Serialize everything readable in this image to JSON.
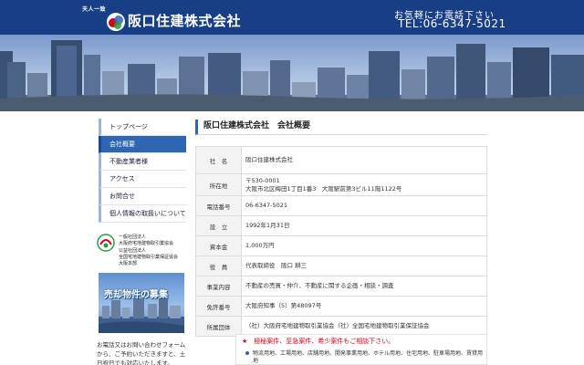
{
  "header": {
    "tagline": "天人一致",
    "company_name": "阪口住建株式会社",
    "call_text": "お気軽にお電話下さい",
    "tel": "TEL:06-6347-5021"
  },
  "colors": {
    "header_bg": "#183f86",
    "accent": "#2f66b3",
    "alert_red": "#d6001c"
  },
  "nav": {
    "items": [
      {
        "label": "トップページ",
        "active": false
      },
      {
        "label": "会社概要",
        "active": true
      },
      {
        "label": "不動産業者様",
        "active": false
      },
      {
        "label": "アクセス",
        "active": false
      },
      {
        "label": "お問合せ",
        "active": false
      },
      {
        "label": "個人情報の取扱いについて",
        "active": false
      }
    ]
  },
  "association": {
    "line1": "一般社団法人",
    "line2": "大阪府宅地建物取引業協会",
    "line3": "公益社団法人",
    "line4": "全国宅地建物取引業保証協会",
    "line5": "大阪本部"
  },
  "sale_banner": {
    "title": "売却物件の募集"
  },
  "side_note": {
    "text": "お電話又はお問い合わせフォームから、ご予約いただきますと、土日祝日でも対応いたします。"
  },
  "main": {
    "title": "阪口住建株式会社　会社概要",
    "rows": [
      {
        "label": "社　名",
        "value": "阪口住建株式会社"
      },
      {
        "label": "所在地",
        "value": "〒530-0001\n大阪市北区梅田1丁目1番3　大阪駅前第3ビル11階1122号"
      },
      {
        "label": "電話番号",
        "value": "06-6347-5021"
      },
      {
        "label": "設　立",
        "value": "1992年1月31日"
      },
      {
        "label": "資本金",
        "value": "1,000万円"
      },
      {
        "label": "役　員",
        "value": "代表取締役　阪口 耕三"
      },
      {
        "label": "事業内容",
        "value": "不動産の売買・仲介、不動産に関する企画・相談・調査"
      },
      {
        "label": "免許番号",
        "value": "大阪府知事（5）第48097号"
      },
      {
        "label": "所属団体",
        "value": "（社）大阪府宅地建物取引業協会（社）全国宅地建物取引業保証協会"
      }
    ],
    "notice_head": "★　極秘案件、至急案件、希少案件もご相談下さい。",
    "notice_body": "物流用地、工場用地、店舗用地、開発事業用地、ホテル用地、住宅用地、駐車場用地、賃貸用地"
  }
}
